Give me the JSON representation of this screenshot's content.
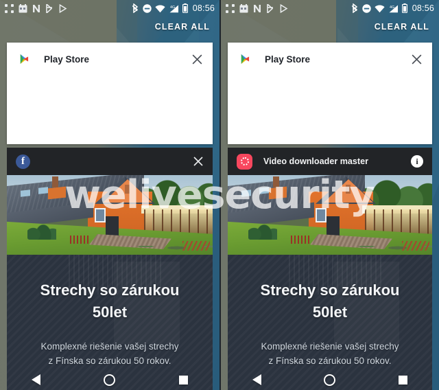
{
  "meta": {
    "watermark": "welivesecurity",
    "accent_blue": "#2d7094",
    "ad_bg": "#2b333f",
    "notif_bar_bg": "#222427",
    "vd_icon_color": "#f8475e",
    "fb_icon_color": "#3b5998"
  },
  "statusbar": {
    "time": "08:56",
    "left_icons": [
      "apps-grid-icon",
      "calendar-icon",
      "nfc-n-icon",
      "play-flag-icon",
      "play-triangle-icon"
    ],
    "right_icons": [
      "bluetooth-icon",
      "do-not-disturb-icon",
      "wifi-icon",
      "cellular-4g-icon",
      "battery-icon"
    ],
    "network_label": "4G"
  },
  "panels": [
    {
      "id": "left",
      "clear_all_label": "CLEAR ALL",
      "notification": {
        "app_icon": "play-store-icon",
        "title": "Play Store",
        "close_icon": "close-icon"
      },
      "ad": {
        "bar": {
          "icon": "facebook-icon",
          "title": "",
          "action_icon": "close-icon"
        },
        "photo_alt": "orange-house-with-dark-roof-and-lawn",
        "headline_line1": "Strechy so zárukou",
        "headline_line2": "50let",
        "subtext_line1": "Komplexné riešenie vašej strechy",
        "subtext_line2": "z Fínska so zárukou 50 rokov."
      },
      "navbar": {
        "back": "back-icon",
        "home": "home-icon",
        "recents": "recents-icon"
      }
    },
    {
      "id": "right",
      "clear_all_label": "CLEAR ALL",
      "notification": {
        "app_icon": "play-store-icon",
        "title": "Play Store",
        "close_icon": "close-icon"
      },
      "ad": {
        "bar": {
          "icon": "video-downloader-master-icon",
          "title": "Video downloader master",
          "action_icon": "info-icon"
        },
        "photo_alt": "orange-house-with-dark-roof-and-lawn",
        "headline_line1": "Strechy so zárukou",
        "headline_line2": "50let",
        "subtext_line1": "Komplexné riešenie vašej strechy",
        "subtext_line2": "z Fínska so zárukou 50 rokov."
      },
      "navbar": {
        "back": "back-icon",
        "home": "home-icon",
        "recents": "recents-icon"
      }
    }
  ]
}
